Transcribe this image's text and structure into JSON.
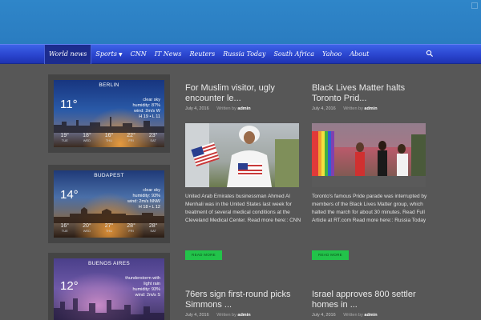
{
  "nav": {
    "items": [
      "World news",
      "Sports",
      "CNN",
      "IT News",
      "Reuters",
      "Russia Today",
      "South Africa",
      "Yahoo",
      "About"
    ]
  },
  "weather": [
    {
      "city": "BERLIN",
      "temp": "11°",
      "details": [
        "clear sky",
        "humidity: 87%",
        "wind: 2m/s W",
        "H 19 • L 11"
      ],
      "forecast": [
        {
          "temp": "19°",
          "day": "TUE"
        },
        {
          "temp": "18°",
          "day": "WED"
        },
        {
          "temp": "16°",
          "day": "THU"
        },
        {
          "temp": "22°",
          "day": "FRI"
        },
        {
          "temp": "23°",
          "day": "SAT"
        }
      ]
    },
    {
      "city": "BUDAPEST",
      "temp": "14°",
      "details": [
        "clear sky",
        "humidity: 93%",
        "wind: 2m/s NNW",
        "H 18 • L 12"
      ],
      "forecast": [
        {
          "temp": "16°",
          "day": "TUE"
        },
        {
          "temp": "20°",
          "day": "WED"
        },
        {
          "temp": "27°",
          "day": "THU"
        },
        {
          "temp": "28°",
          "day": "FRI"
        },
        {
          "temp": "28°",
          "day": "SAT"
        }
      ]
    },
    {
      "city": "BUENOS AIRES",
      "temp": "12°",
      "details": [
        "thunderstorm with",
        "light rain",
        "humidity: 93%",
        "wind: 2m/s S"
      ],
      "forecast": []
    }
  ],
  "articles": [
    {
      "title": "For Muslim visitor, ugly encounter le...",
      "date": "July 4, 2016",
      "by": "Written by",
      "author": "admin",
      "excerpt": "United Arab Emirates businessman Ahmed Al Menhali was in the United States last week for treatment of several medical conditions at the Cleveland Medical Center. Read more here:: CNN",
      "read_more": "READ MORE"
    },
    {
      "title": "Black Lives Matter halts Toronto Prid...",
      "date": "July 4, 2016",
      "by": "Written by",
      "author": "admin",
      "excerpt": "Toronto's famous Pride parade was interrupted by members of the Black Lives Matter group, which halted the march for about 30 minutes. Read Full Article at RT.com Read more here:: Russia Today",
      "read_more": "READ MORE"
    },
    {
      "title": "76ers sign first-round picks Simmons ...",
      "date": "July 4, 2016",
      "by": "Written by",
      "author": "admin"
    },
    {
      "title": "Israel approves 800 settler homes in ...",
      "date": "July 4, 2016",
      "by": "Written by",
      "author": "admin"
    }
  ],
  "colors": {
    "banner": "#2a7cc0",
    "nav": "#2a45cf",
    "background": "#575757",
    "card": "#444444",
    "read_more": "#22c34a"
  }
}
